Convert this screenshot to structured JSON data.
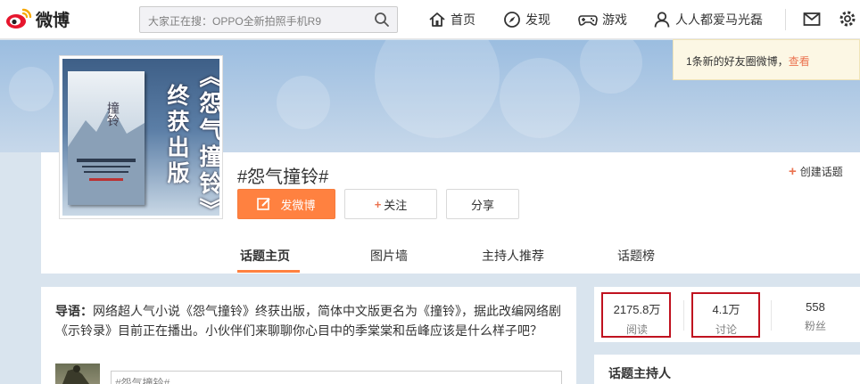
{
  "brand": {
    "logo_text": "微博",
    "logo_color": "#e6162d"
  },
  "search": {
    "placeholder": "大家正在搜：OPPO全新拍照手机R9"
  },
  "nav": {
    "home": "首页",
    "discover": "发现",
    "games": "游戏",
    "user": "人人都爱马光磊"
  },
  "notice": {
    "text": "1条新的好友圈微博，",
    "link": "查看"
  },
  "cover": {
    "line1": "《怨气撞铃》",
    "line2": "终获出版",
    "book_title": "撞铃"
  },
  "topic": {
    "title": "#怨气撞铃#",
    "create_label": "创建话题",
    "post_button": "发微博",
    "follow_button": "关注",
    "share_button": "分享"
  },
  "tabs": [
    "话题主页",
    "图片墙",
    "主持人推荐",
    "话题榜"
  ],
  "intro": {
    "label": "导语：",
    "text": "网络超人气小说《怨气撞铃》终获出版，简体中文版更名为《撞铃》，据此改编网络剧《示铃录》目前正在播出。小伙伴们来聊聊你心目中的季棠棠和岳峰应该是什么样子吧？"
  },
  "compose": {
    "text": "#怨气撞铃#"
  },
  "stats": [
    {
      "value": "2175.8万",
      "label": "阅读"
    },
    {
      "value": "4.1万",
      "label": "讨论"
    },
    {
      "value": "558",
      "label": "粉丝"
    }
  ],
  "host": {
    "title": "话题主持人"
  },
  "colors": {
    "accent": "#ff8140",
    "highlight_box": "#c0121f",
    "banner": "#9bbde0"
  }
}
